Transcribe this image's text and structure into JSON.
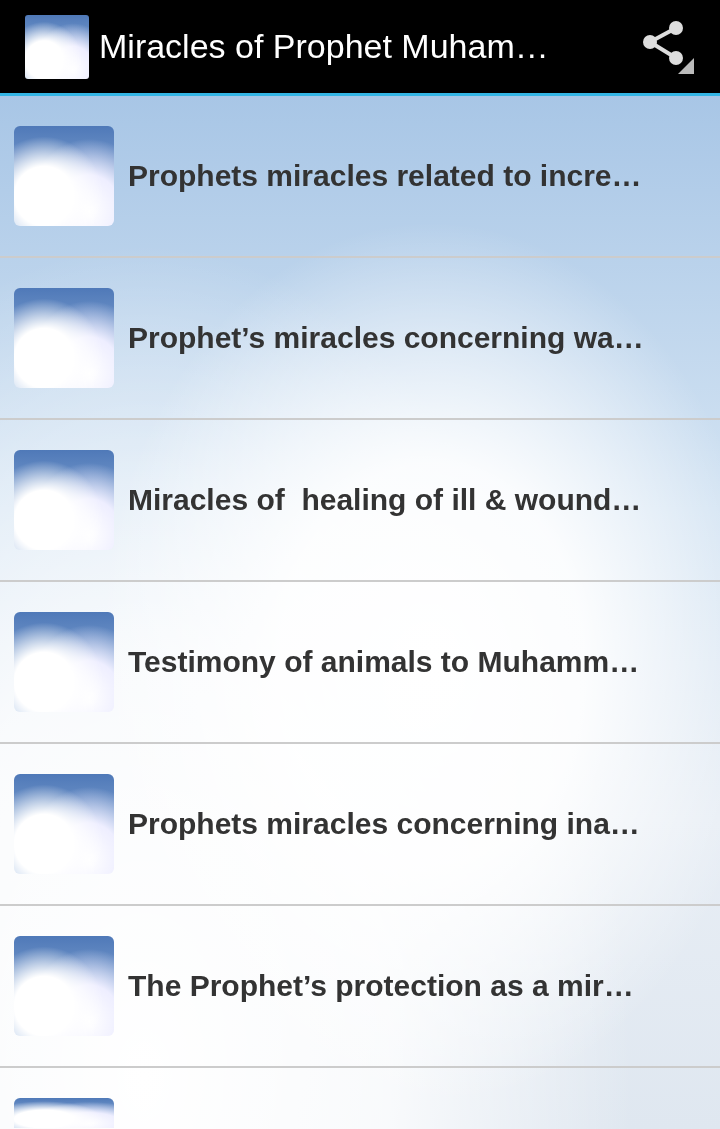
{
  "app_bar": {
    "title": "Miracles of Prophet Muham…"
  },
  "items": [
    {
      "kind": "full",
      "title": "Prophets miracles related to incre…"
    },
    {
      "kind": "full",
      "title": "Prophet’s miracles concerning wa…"
    },
    {
      "kind": "full",
      "title": "Miracles of  healing of ill & wound…"
    },
    {
      "kind": "full",
      "title": "Testimony of animals to Muhamm…"
    },
    {
      "kind": "full",
      "title": "Prophets miracles concerning ina…"
    },
    {
      "kind": "full",
      "title": "The Prophet’s protection as a mir…"
    },
    {
      "kind": "cut"
    }
  ]
}
